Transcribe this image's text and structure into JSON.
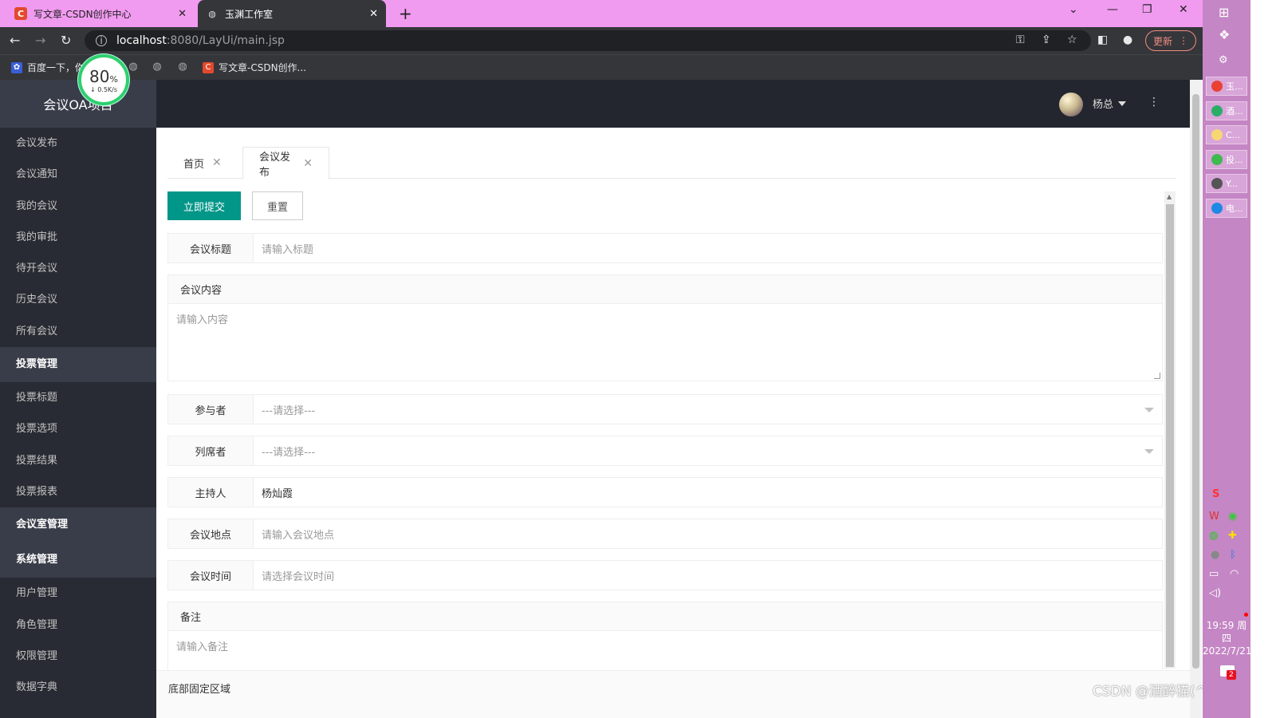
{
  "browser": {
    "tabs": [
      {
        "label": "写文章-CSDN创作中心",
        "favicon": "C"
      },
      {
        "label": "玉渊工作室",
        "active": true
      }
    ],
    "url_host": "localhost",
    "url_path": ":8080/LayUi/main.jsp",
    "update_label": "更新",
    "bookmarks": [
      {
        "label": "百度一下，你"
      },
      {
        "label": "写文章-CSDN创作..."
      }
    ]
  },
  "speed_badge": {
    "percent": "80",
    "unit": "%",
    "rate": "↓ 0.5K/s"
  },
  "app": {
    "logo": "会议OA项目",
    "user": "杨总",
    "sidebar": {
      "items": [
        {
          "label": "会议发布",
          "group": false
        },
        {
          "label": "会议通知",
          "group": false
        },
        {
          "label": "我的会议",
          "group": false
        },
        {
          "label": "我的审批",
          "group": false
        },
        {
          "label": "待开会议",
          "group": false
        },
        {
          "label": "历史会议",
          "group": false
        },
        {
          "label": "所有会议",
          "group": false
        },
        {
          "label": "投票管理",
          "group": true
        },
        {
          "label": "投票标题",
          "group": false
        },
        {
          "label": "投票选项",
          "group": false
        },
        {
          "label": "投票结果",
          "group": false
        },
        {
          "label": "投票报表",
          "group": false
        },
        {
          "label": "会议室管理",
          "group": true
        },
        {
          "label": "系统管理",
          "group": true
        },
        {
          "label": "用户管理",
          "group": false
        },
        {
          "label": "角色管理",
          "group": false
        },
        {
          "label": "权限管理",
          "group": false
        },
        {
          "label": "数据字典",
          "group": false
        }
      ]
    },
    "content_tabs": [
      {
        "label": "首页"
      },
      {
        "label": "会议发布",
        "active": true
      }
    ],
    "form": {
      "submit_label": "立即提交",
      "reset_label": "重置",
      "title": {
        "label": "会议标题",
        "placeholder": "请输入标题"
      },
      "content": {
        "label": "会议内容",
        "placeholder": "请输入内容"
      },
      "participants": {
        "label": "参与者",
        "selected": "---请选择---"
      },
      "attendees": {
        "label": "列席者",
        "selected": "---请选择---"
      },
      "host": {
        "label": "主持人",
        "value": "杨灿霞"
      },
      "location": {
        "label": "会议地点",
        "placeholder": "请输入会议地点"
      },
      "time": {
        "label": "会议时间",
        "placeholder": "请选择会议时间"
      },
      "remark": {
        "label": "备注",
        "placeholder": "请输入备注"
      }
    },
    "footer": "底部固定区域"
  },
  "watermark": "CSDN @酒醉猫(^･ｪ･^)",
  "taskbar": {
    "tasks": [
      {
        "label": "玉...",
        "icon": "chrome-icon",
        "color": "#e94235"
      },
      {
        "label": "酒...",
        "icon": "wechat-icon",
        "color": "#2aae67"
      },
      {
        "label": "C...",
        "icon": "note-icon",
        "color": "#f7d774"
      },
      {
        "label": "投...",
        "icon": "app-icon",
        "color": "#3fb950"
      },
      {
        "label": "Y...",
        "icon": "gear-icon",
        "color": "#555555"
      },
      {
        "label": "电...",
        "icon": "video-icon",
        "color": "#1e88e5"
      }
    ],
    "time": "19:59 周四",
    "date": "2022/7/21",
    "notification_count": "2"
  },
  "colors": {
    "primary": "#009688",
    "sidebar_bg": "#282b33",
    "header_bg": "#23262e",
    "tabstrip_bg": "#f19bf0",
    "taskbar_bg": "#c486c4"
  }
}
